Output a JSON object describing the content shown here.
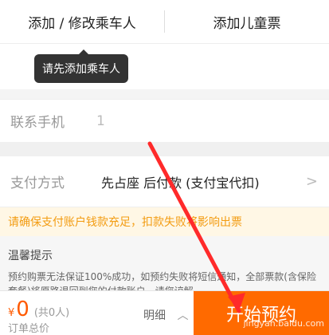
{
  "tabs": [
    "添加 / 修改乘车人",
    "添加儿童票"
  ],
  "tooltip": "请先添加乘车人",
  "contact": {
    "label": "联系手机",
    "value": "1"
  },
  "payment": {
    "label": "支付方式",
    "value": "先占座 后付款 (支付宝代扣)",
    "chevron": ">"
  },
  "warning": "请确保支付账户钱款充足，扣款失败将影响出票",
  "tips": {
    "title": "温馨提示",
    "text": "预约购票无法保证100%成功，如预约失败将短信通知，全部票款(含保险套餐)将原路退回到您的付款账户，请您谅解。"
  },
  "bottom": {
    "currency": "¥",
    "amount": "0",
    "count": "(共0人)",
    "total_label": "订单总价",
    "detail": "明细",
    "submit": "开始预约",
    "watermark": "jingyan.baidu.com"
  },
  "colors": {
    "accent": "#ff6a00",
    "arrow": "#ff2a2a"
  }
}
